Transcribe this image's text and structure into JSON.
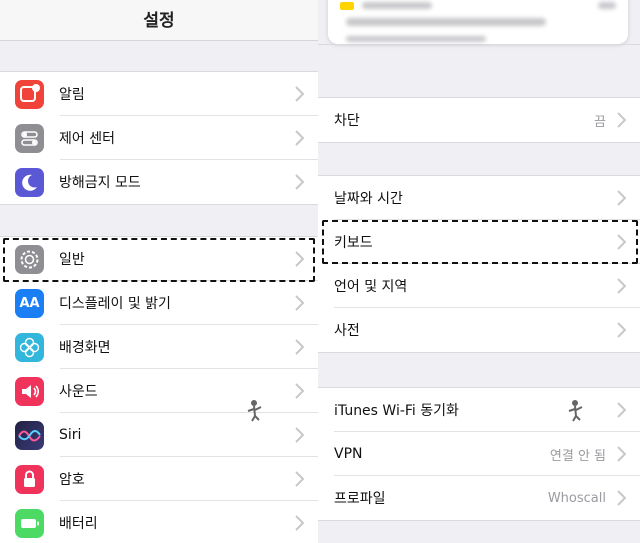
{
  "left": {
    "nav_title": "설정",
    "group1": [
      {
        "label": "알림",
        "icon": "notifications-icon",
        "color": "#f0433a"
      },
      {
        "label": "제어 센터",
        "icon": "control-center-icon",
        "color": "#8e8e93"
      },
      {
        "label": "방해금지 모드",
        "icon": "moon-icon",
        "color": "#5b58d6"
      }
    ],
    "group2": [
      {
        "label": "일반",
        "icon": "gear-icon",
        "color": "#8e8e93"
      },
      {
        "label": "디스플레이 및 밝기",
        "icon": "display-brightness-icon",
        "color": "#1a7ef5",
        "glyph": "AA"
      },
      {
        "label": "배경화면",
        "icon": "wallpaper-icon",
        "color": "#33b6dc"
      },
      {
        "label": "사운드",
        "icon": "speaker-icon",
        "color": "#f0335a"
      },
      {
        "label": "Siri",
        "icon": "siri-icon",
        "color": "#222244"
      },
      {
        "label": "암호",
        "icon": "lock-icon",
        "color": "#f0335a"
      },
      {
        "label": "배터리",
        "icon": "battery-icon",
        "color": "#4cd964"
      }
    ]
  },
  "right": {
    "group_block": {
      "label": "차단",
      "value": "끔"
    },
    "group_general": [
      {
        "label": "날짜와 시간"
      },
      {
        "label": "키보드"
      },
      {
        "label": "언어 및 지역"
      },
      {
        "label": "사전"
      }
    ],
    "group_network": [
      {
        "label": "iTunes Wi-Fi 동기화",
        "value": ""
      },
      {
        "label": "VPN",
        "value": "연결 안 됨"
      },
      {
        "label": "프로파일",
        "value": "Whoscall"
      }
    ]
  }
}
